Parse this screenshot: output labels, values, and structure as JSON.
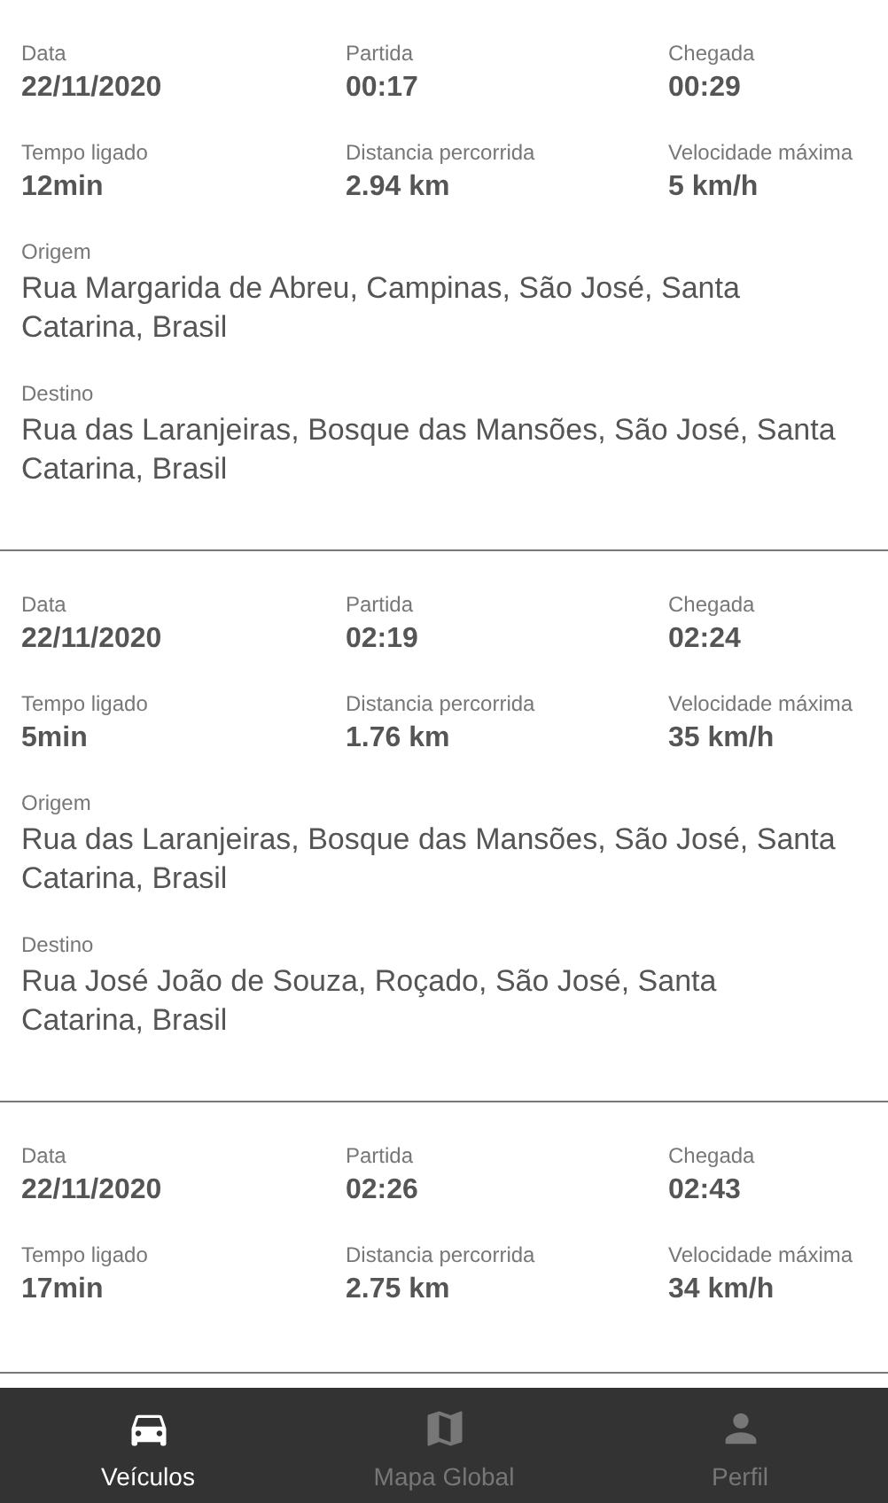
{
  "trips": [
    {
      "stats": [
        {
          "label": "Data",
          "value": "22/11/2020"
        },
        {
          "label": "Partida",
          "value": "00:17"
        },
        {
          "label": "Chegada",
          "value": "00:29"
        },
        {
          "label": "Tempo ligado",
          "value": "12min"
        },
        {
          "label": "Distancia percorrida",
          "value": "2.94 km"
        },
        {
          "label": "Velocidade máxima",
          "value": "5 km/h"
        }
      ],
      "places": [
        {
          "label": "Origem",
          "value": "Rua Margarida de Abreu, Campinas, São José, Santa Catarina, Brasil"
        },
        {
          "label": "Destino",
          "value": "Rua das Laranjeiras, Bosque das Mansões, São José, Santa Catarina, Brasil"
        }
      ]
    },
    {
      "stats": [
        {
          "label": "Data",
          "value": "22/11/2020"
        },
        {
          "label": "Partida",
          "value": "02:19"
        },
        {
          "label": "Chegada",
          "value": "02:24"
        },
        {
          "label": "Tempo ligado",
          "value": "5min"
        },
        {
          "label": "Distancia percorrida",
          "value": "1.76 km"
        },
        {
          "label": "Velocidade máxima",
          "value": "35 km/h"
        }
      ],
      "places": [
        {
          "label": "Origem",
          "value": "Rua das Laranjeiras, Bosque das Mansões, São José, Santa Catarina, Brasil"
        },
        {
          "label": "Destino",
          "value": "Rua José João de Souza, Roçado, São José, Santa Catarina, Brasil"
        }
      ]
    },
    {
      "stats": [
        {
          "label": "Data",
          "value": "22/11/2020"
        },
        {
          "label": "Partida",
          "value": "02:26"
        },
        {
          "label": "Chegada",
          "value": "02:43"
        },
        {
          "label": "Tempo ligado",
          "value": "17min"
        },
        {
          "label": "Distancia percorrida",
          "value": "2.75 km"
        },
        {
          "label": "Velocidade máxima",
          "value": "34 km/h"
        }
      ]
    }
  ],
  "nav": [
    {
      "kind": "car",
      "label": "Veículos",
      "selected": true
    },
    {
      "kind": "map",
      "label": "Mapa Global",
      "selected": false
    },
    {
      "kind": "person",
      "label": "Perfil",
      "selected": false
    }
  ]
}
